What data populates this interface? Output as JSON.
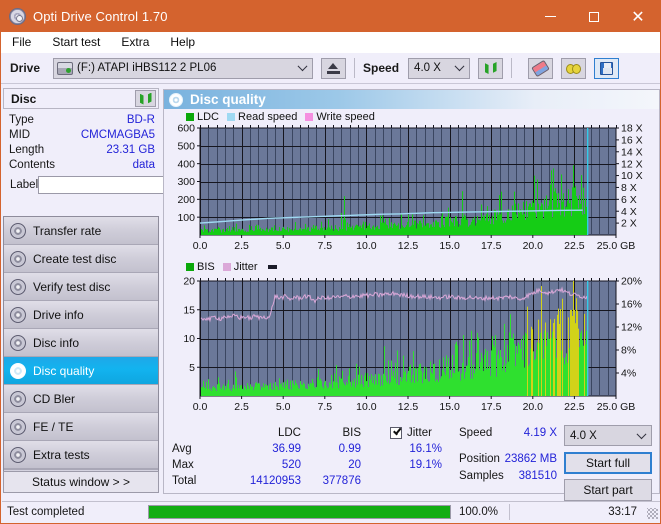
{
  "window": {
    "title": "Opti Drive Control 1.70",
    "icon": "disc-icon",
    "minimize": "–",
    "maximize": "□",
    "close": "✕"
  },
  "menubar": {
    "items": [
      {
        "label": "File",
        "name": "menu-file"
      },
      {
        "label": "Start test",
        "name": "menu-start-test"
      },
      {
        "label": "Extra",
        "name": "menu-extra"
      },
      {
        "label": "Help",
        "name": "menu-help"
      }
    ]
  },
  "drivebar": {
    "drive_label": "Drive",
    "drive_value": "(F:)   ATAPI iHBS112  2 PL06",
    "eject_icon": "eject-icon",
    "speed_label": "Speed",
    "speed_value": "4.0 X",
    "refresh_icon": "refresh-icon",
    "eraser_icon": "eraser-icon",
    "glasses_icon": "glasses-icon",
    "save_icon": "save-icon"
  },
  "disc": {
    "header": "Disc",
    "refresh_icon": "refresh-icon",
    "rows": [
      {
        "key": "Type",
        "value": "BD-R"
      },
      {
        "key": "MID",
        "value": "CMCMAGBA5"
      },
      {
        "key": "Length",
        "value": "23.31 GB"
      },
      {
        "key": "Contents",
        "value": "data"
      }
    ],
    "label_key": "Label",
    "label_value": "",
    "label_placeholder": "",
    "disc_icon": "cd-icon"
  },
  "nav": {
    "items": [
      {
        "label": "Transfer rate",
        "name": "sidebar-item-transfer-rate",
        "active": false
      },
      {
        "label": "Create test disc",
        "name": "sidebar-item-create-test-disc",
        "active": false
      },
      {
        "label": "Verify test disc",
        "name": "sidebar-item-verify-test-disc",
        "active": false
      },
      {
        "label": "Drive info",
        "name": "sidebar-item-drive-info",
        "active": false
      },
      {
        "label": "Disc info",
        "name": "sidebar-item-disc-info",
        "active": false
      },
      {
        "label": "Disc quality",
        "name": "sidebar-item-disc-quality",
        "active": true
      },
      {
        "label": "CD Bler",
        "name": "sidebar-item-cd-bler",
        "active": false
      },
      {
        "label": "FE / TE",
        "name": "sidebar-item-fe-te",
        "active": false
      },
      {
        "label": "Extra tests",
        "name": "sidebar-item-extra-tests",
        "active": false
      }
    ],
    "status_window": "Status window > >"
  },
  "panel": {
    "title": "Disc quality",
    "icon": "disc-quality-icon"
  },
  "stats": {
    "col_ldc": "LDC",
    "col_bis": "BIS",
    "row_avg": "Avg",
    "row_max": "Max",
    "row_total": "Total",
    "ldc_avg": "36.99",
    "ldc_max": "520",
    "ldc_total": "14120953",
    "bis_avg": "0.99",
    "bis_max": "20",
    "bis_total": "377876",
    "jitter_label": "Jitter",
    "jitter_avg": "16.1%",
    "jitter_max": "19.1%",
    "speed_label": "Speed",
    "speed_value": "4.19 X",
    "position_label": "Position",
    "position_value": "23862 MB",
    "samples_label": "Samples",
    "samples_value": "381510",
    "speed_select": "4.0 X",
    "start_full": "Start full",
    "start_part": "Start part"
  },
  "statusbar": {
    "text": "Test completed",
    "percent": "100.0%",
    "progress": 100,
    "time": "33:17"
  },
  "colors": {
    "titlebar": "#d4632e",
    "accent_blue": "#12b3ef",
    "value_blue": "#2323d8",
    "ldc_green": "#15cc15",
    "bis_yellow": "#d2d219",
    "read_speed": "#9fd9f2",
    "jitter_pink": "#dba8d8",
    "plot_bg": "#6b7899",
    "progress_green": "#13ad13"
  },
  "chart_data": [
    {
      "type": "area",
      "name": "ldc-chart",
      "title": "",
      "xlabel": "GB",
      "ylabel": "",
      "xlim": [
        0,
        25
      ],
      "ylim": [
        0,
        600
      ],
      "y2lim": [
        0,
        18
      ],
      "y2label": "X",
      "grid": true,
      "legend": [
        "LDC",
        "Read speed",
        "Write speed"
      ],
      "legend_colors": [
        "#0aa80a",
        "#9fd9f2",
        "#f58fe0"
      ],
      "xticks": [
        "0.0",
        "2.5",
        "5.0",
        "7.5",
        "10.0",
        "12.5",
        "15.0",
        "17.5",
        "20.0",
        "22.5",
        "25.0 GB"
      ],
      "yticks": [
        "100",
        "200",
        "300",
        "400",
        "500",
        "600"
      ],
      "y2ticks": [
        "2 X",
        "4 X",
        "6 X",
        "8 X",
        "10 X",
        "12 X",
        "14 X",
        "16 X",
        "18 X"
      ],
      "series": [
        {
          "name": "LDC",
          "color": "#15cc15",
          "kind": "spikes",
          "x": [
            0.0,
            0.2,
            0.4,
            0.6,
            0.8,
            1.0,
            1.2,
            1.4,
            1.6,
            1.8,
            2.0,
            2.2,
            2.4,
            2.6,
            2.8,
            3.0,
            3.2,
            3.4,
            3.6,
            3.8,
            4.0,
            4.2,
            4.4,
            4.6,
            4.8,
            5.0,
            5.2,
            5.4,
            5.6,
            5.8,
            6.0,
            6.2,
            6.4,
            6.6,
            6.8,
            7.0,
            7.2,
            7.4,
            7.6,
            7.8,
            8.0,
            8.2,
            8.4,
            8.6,
            8.8,
            9.0,
            9.2,
            9.4,
            9.6,
            9.8,
            10.0,
            10.2,
            10.4,
            10.6,
            10.8,
            11.0,
            11.2,
            11.4,
            11.6,
            11.8,
            12.0,
            12.2,
            12.4,
            12.6,
            12.8,
            13.0,
            13.2,
            13.4,
            13.6,
            13.8,
            14.0,
            14.2,
            14.4,
            14.6,
            14.8,
            15.0,
            15.2,
            15.4,
            15.6,
            15.8,
            16.0,
            16.2,
            16.4,
            16.6,
            16.8,
            17.0,
            17.2,
            17.4,
            17.6,
            17.8,
            18.0,
            18.2,
            18.4,
            18.6,
            18.8,
            19.0,
            19.2,
            19.4,
            19.6,
            19.8,
            20.0,
            20.2,
            20.4,
            20.6,
            20.8,
            21.0,
            21.2,
            21.4,
            21.6,
            21.8,
            22.0,
            22.2,
            22.4,
            22.6,
            22.8,
            23.0,
            23.2,
            23.3
          ],
          "y": [
            275,
            40,
            35,
            45,
            30,
            35,
            40,
            30,
            55,
            35,
            180,
            40,
            345,
            360,
            100,
            45,
            40,
            60,
            250,
            35,
            310,
            30,
            50,
            365,
            40,
            45,
            35,
            40,
            30,
            35,
            40,
            35,
            45,
            30,
            35,
            270,
            40,
            35,
            50,
            30,
            40,
            35,
            45,
            315,
            280,
            40,
            35,
            50,
            40,
            35,
            45,
            60,
            55,
            50,
            40,
            290,
            345,
            60,
            330,
            390,
            55,
            230,
            60,
            55,
            50,
            60,
            65,
            70,
            60,
            55,
            150,
            60,
            265,
            55,
            60,
            70,
            430,
            75,
            70,
            300,
            65,
            330,
            70,
            75,
            80,
            90,
            85,
            250,
            95,
            90,
            280,
            300,
            100,
            380,
            110,
            430,
            115,
            120,
            420,
            105,
            110,
            230,
            120,
            115,
            300,
            440,
            125,
            460,
            130,
            200,
            135,
            420,
            450,
            140,
            150,
            145,
            160,
            155
          ]
        },
        {
          "name": "Read speed",
          "color": "#9fd9f2",
          "kind": "line",
          "x": [
            0.0,
            0.5,
            1.0,
            1.5,
            2.0,
            2.5,
            3.0,
            3.5,
            4.0,
            4.5,
            5.0,
            5.5,
            6.0,
            6.5,
            7.0,
            7.5,
            8.0,
            8.5,
            9.0,
            9.5,
            10.0,
            10.5,
            11.0,
            11.5,
            12.0,
            12.5,
            13.0,
            13.5,
            14.0,
            15.0,
            16.0,
            17.0,
            18.0,
            19.0,
            20.0,
            21.0,
            22.0,
            23.0,
            23.3
          ],
          "y_right_x": [
            2.0,
            2.1,
            2.2,
            2.3,
            2.4,
            2.5,
            2.6,
            2.7,
            2.8,
            2.85,
            2.9,
            2.95,
            3.0,
            3.05,
            3.1,
            3.15,
            3.2,
            3.25,
            3.3,
            3.35,
            3.4,
            3.45,
            3.5,
            3.52,
            3.55,
            3.6,
            3.65,
            3.7,
            3.75,
            3.8,
            3.85,
            3.9,
            3.95,
            4.0,
            4.05,
            4.1,
            4.15,
            4.18,
            18.0
          ]
        },
        {
          "name": "Write speed",
          "color": "#f58fe0",
          "kind": "none",
          "x": [],
          "y": []
        }
      ]
    },
    {
      "type": "area",
      "name": "bis-jitter-chart",
      "title": "",
      "xlabel": "GB",
      "ylabel": "",
      "xlim": [
        0,
        25
      ],
      "ylim": [
        0,
        20
      ],
      "y2lim": [
        0,
        20
      ],
      "y2label": "%",
      "grid": true,
      "legend": [
        "BIS",
        "Jitter"
      ],
      "legend_colors": [
        "#0aa80a",
        "#dba8d8"
      ],
      "xticks": [
        "0.0",
        "2.5",
        "5.0",
        "7.5",
        "10.0",
        "12.5",
        "15.0",
        "17.5",
        "20.0",
        "22.5",
        "25.0 GB"
      ],
      "yticks": [
        "5",
        "10",
        "15",
        "20"
      ],
      "y2ticks": [
        "4%",
        "8%",
        "12%",
        "16%",
        "20%"
      ],
      "series": [
        {
          "name": "BIS",
          "color": "#15cc15",
          "kind": "spikes",
          "x": [
            0.0,
            0.3,
            0.6,
            0.9,
            1.2,
            1.5,
            1.8,
            2.1,
            2.4,
            2.7,
            3.0,
            3.3,
            3.6,
            3.9,
            4.2,
            4.5,
            4.8,
            5.1,
            5.4,
            5.7,
            6.0,
            6.3,
            6.6,
            6.9,
            7.2,
            7.5,
            7.8,
            8.1,
            8.4,
            8.7,
            9.0,
            9.3,
            9.6,
            9.9,
            10.2,
            10.5,
            10.8,
            11.1,
            11.4,
            11.7,
            12.0,
            12.3,
            12.6,
            12.9,
            13.2,
            13.5,
            13.8,
            14.1,
            14.4,
            14.7,
            15.0,
            15.3,
            15.6,
            15.9,
            16.2,
            16.5,
            16.8,
            17.1,
            17.4,
            17.7,
            18.0,
            18.3,
            18.6,
            18.9,
            19.2,
            19.5,
            19.8,
            20.1,
            20.4,
            20.7,
            21.0,
            21.3,
            21.6,
            21.9,
            22.2,
            22.5,
            22.8,
            23.1,
            23.3
          ],
          "y": [
            1.4,
            2.0,
            1.6,
            2.2,
            1.8,
            5.3,
            2.0,
            6.1,
            2.4,
            5.0,
            2.2,
            2.6,
            2.4,
            3.0,
            6.8,
            2.4,
            2.6,
            2.8,
            3.0,
            2.6,
            2.8,
            3.2,
            3.0,
            3.4,
            3.2,
            3.6,
            3.4,
            5.6,
            5.2,
            3.8,
            4.0,
            4.4,
            4.2,
            4.6,
            4.4,
            5.0,
            4.8,
            12.1,
            5.2,
            9.6,
            5.4,
            5.8,
            5.6,
            6.0,
            5.8,
            12.3,
            6.2,
            6.6,
            6.4,
            6.8,
            7.0,
            7.4,
            7.2,
            7.6,
            7.8,
            8.2,
            8.0,
            8.4,
            8.6,
            9.0,
            9.4,
            9.2,
            9.8,
            10.2,
            10.6,
            11.0,
            11.4,
            14.6,
            12.2,
            16.8,
            13.0,
            13.6,
            15.8,
            14.2,
            15.0,
            17.4,
            15.2,
            14.4,
            13.8
          ]
        },
        {
          "name": "Jitter",
          "color": "#dba8d8",
          "kind": "line",
          "x": [
            0.0,
            0.3,
            0.6,
            0.9,
            1.2,
            1.5,
            1.8,
            2.1,
            2.4,
            2.7,
            3.0,
            3.3,
            3.6,
            3.9,
            4.2,
            4.5,
            4.8,
            5.1,
            5.4,
            5.7,
            6.0,
            6.3,
            6.6,
            6.9,
            7.2,
            7.5,
            7.8,
            8.1,
            8.4,
            8.7,
            9.0,
            9.3,
            9.6,
            9.9,
            10.2,
            10.5,
            10.8,
            11.1,
            11.4,
            11.7,
            12.0,
            12.6,
            13.2,
            13.8,
            14.4,
            15.0,
            15.6,
            16.2,
            16.8,
            17.4,
            18.0,
            18.6,
            19.2,
            19.8,
            20.4,
            21.0,
            21.6,
            22.2,
            22.8,
            23.3
          ],
          "y": [
            13.2,
            13.6,
            13.3,
            13.8,
            13.4,
            13.9,
            13.5,
            14.1,
            13.6,
            13.8,
            13.5,
            13.9,
            13.6,
            13.8,
            13.7,
            17.4,
            17.0,
            17.3,
            16.8,
            17.2,
            17.0,
            17.4,
            17.1,
            16.6,
            17.0,
            17.2,
            16.9,
            17.3,
            17.1,
            17.4,
            17.2,
            17.5,
            17.3,
            17.6,
            17.4,
            17.7,
            17.5,
            17.8,
            17.6,
            17.9,
            17.6,
            17.4,
            17.3,
            17.2,
            17.1,
            17.3,
            17.0,
            17.2,
            16.9,
            17.1,
            17.0,
            17.3,
            16.8,
            17.6,
            18.4,
            17.9,
            18.6,
            17.8,
            17.4,
            17.2
          ]
        }
      ]
    }
  ]
}
